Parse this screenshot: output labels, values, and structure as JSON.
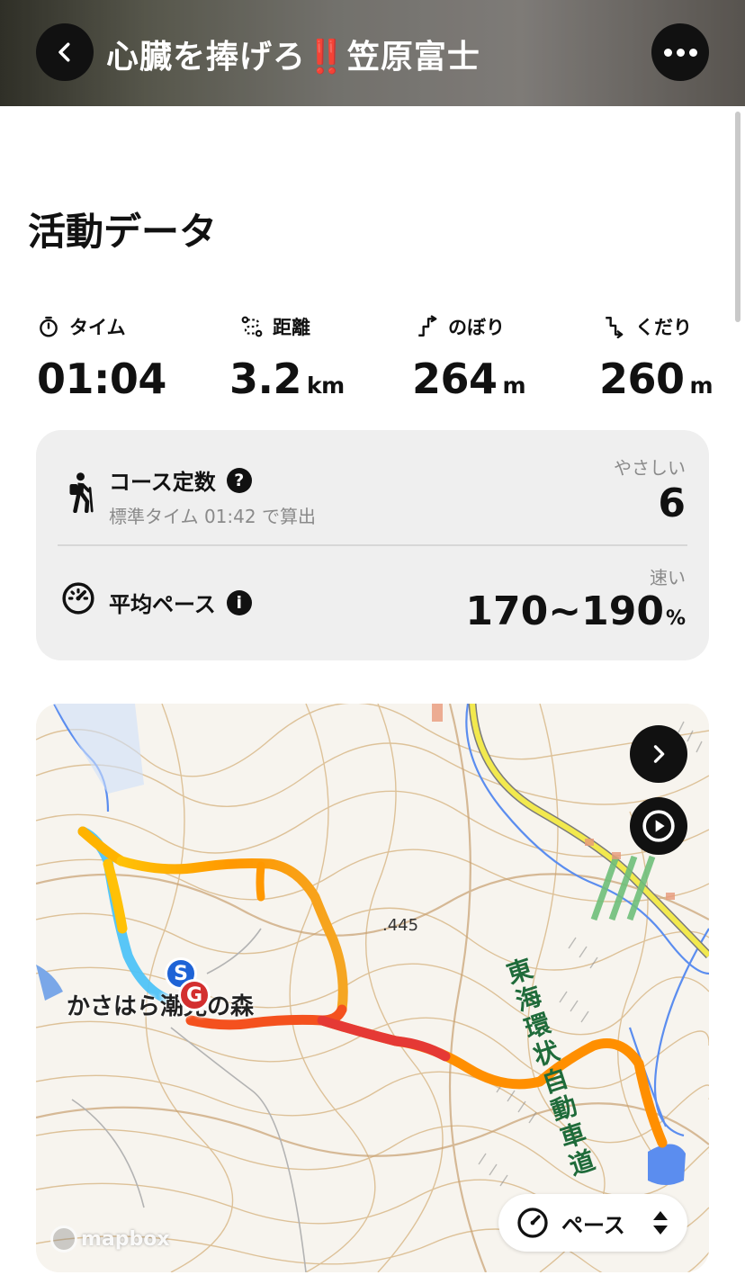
{
  "header": {
    "title": "心臓を捧げろ‼️笠原富士",
    "back_icon": "chevron-left-icon",
    "more_icon": "more-horizontal-icon"
  },
  "section_title": "活動データ",
  "stats": [
    {
      "icon": "stopwatch-icon",
      "label": "タイム",
      "value": "01:04",
      "unit": ""
    },
    {
      "icon": "route-icon",
      "label": "距離",
      "value": "3.2",
      "unit": "km"
    },
    {
      "icon": "ascent-icon",
      "label": "のぼり",
      "value": "264",
      "unit": "m"
    },
    {
      "icon": "descent-icon",
      "label": "くだり",
      "value": "260",
      "unit": "m"
    }
  ],
  "course": {
    "title": "コース定数",
    "help": "?",
    "subtitle": "標準タイム 01:42 で算出",
    "rating_label": "やさしい",
    "value": "6"
  },
  "pace": {
    "title": "平均ペース",
    "info": "i",
    "rating_label": "速い",
    "value": "170~190",
    "unit": "%"
  },
  "map": {
    "place_name": "かさはら潮見の森",
    "elevation": ".445",
    "road_name": "東海環状自動車道",
    "start_marker": "S",
    "goal_marker": "G",
    "pace_selector": "ペース",
    "attribution": "mapbox",
    "route_colors": [
      "#4fc3f7",
      "#ffc107",
      "#ff9800",
      "#e53935"
    ]
  }
}
